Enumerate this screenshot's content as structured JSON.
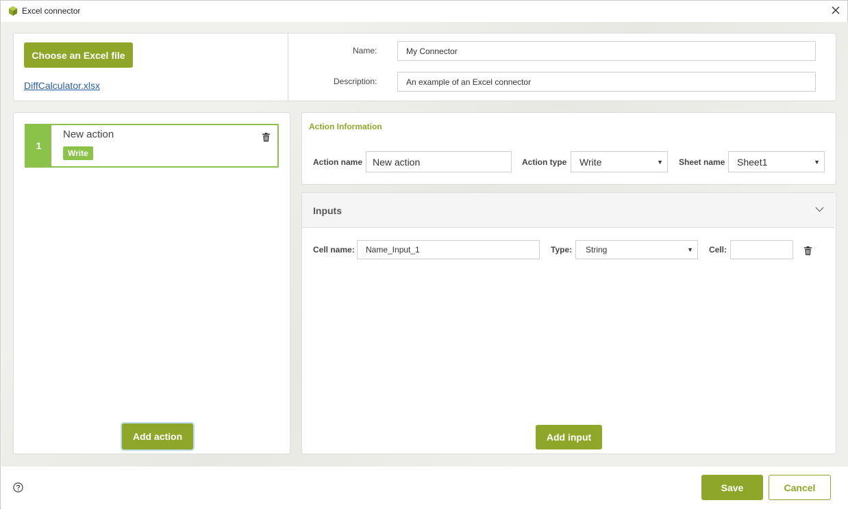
{
  "window": {
    "title": "Excel connector"
  },
  "file": {
    "choose_label": "Choose an Excel file",
    "filename": "DiffCalculator.xlsx"
  },
  "connector": {
    "name_label": "Name:",
    "name_value": "My Connector",
    "description_label": "Description:",
    "description_value": "An example of an Excel connector"
  },
  "actions": {
    "items": [
      {
        "number": "1",
        "title": "New action",
        "type_badge": "Write"
      }
    ],
    "add_label": "Add action"
  },
  "action_info": {
    "section_title": "Action Information",
    "action_name_label": "Action name",
    "action_name_value": "New action",
    "action_type_label": "Action type",
    "action_type_value": "Write",
    "sheet_name_label": "Sheet name",
    "sheet_name_value": "Sheet1"
  },
  "inputs": {
    "section_title": "Inputs",
    "rows": [
      {
        "cell_name_label": "Cell name:",
        "cell_name_value": "Name_Input_1",
        "type_label": "Type:",
        "type_value": "String",
        "cell_label": "Cell:",
        "cell_value": ""
      }
    ],
    "add_label": "Add input"
  },
  "footer": {
    "save_label": "Save",
    "cancel_label": "Cancel"
  },
  "colors": {
    "accent": "#8ea728",
    "action_green": "#8bc34a",
    "link": "#2b5ea8"
  },
  "icons": [
    "excel-connector-logo-icon",
    "close-icon",
    "trash-icon",
    "chevron-down-icon",
    "help-icon"
  ]
}
